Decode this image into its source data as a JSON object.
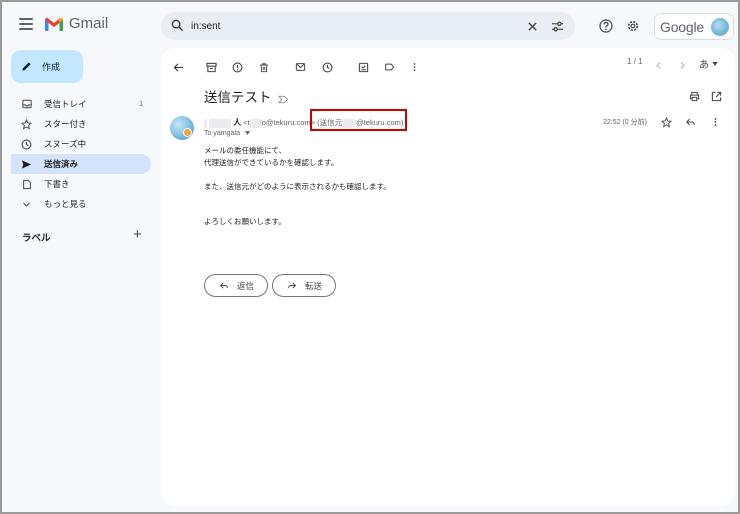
{
  "app": {
    "name": "Gmail"
  },
  "search": {
    "value": "in:sent"
  },
  "account": {
    "brand": "Google"
  },
  "sidebar": {
    "compose_label": "作成",
    "items": [
      {
        "label": "受信トレイ",
        "count": "1",
        "icon": "inbox-icon"
      },
      {
        "label": "スター付き",
        "count": "",
        "icon": "star-icon"
      },
      {
        "label": "スヌーズ中",
        "count": "",
        "icon": "clock-icon"
      },
      {
        "label": "送信済み",
        "count": "",
        "icon": "send-icon",
        "active": true
      },
      {
        "label": "下書き",
        "count": "",
        "icon": "draft-icon"
      },
      {
        "label": "もっと見る",
        "count": "",
        "icon": "chevron-down-icon"
      }
    ],
    "labels_heading": "ラベル"
  },
  "toolbar": {
    "pager": "1 / 1",
    "input_tool": "あ"
  },
  "email": {
    "subject": "送信テスト",
    "sender_name": "人",
    "sender_email_prefix": "<t",
    "sender_email_suffix": "o@tekuru.com>",
    "on_behalf_prefix": "(送信元",
    "on_behalf_suffix": "@tekuru.com)",
    "to": "To yamgata",
    "time": "22:52 (0 分前)",
    "body": [
      "メールの委任機能にて、",
      "代理送信ができているかを確認します。",
      "また、送信元がどのように表示されるかも確認します。",
      "よろしくお願いします。"
    ]
  },
  "actions": {
    "reply_label": "返信",
    "forward_label": "転送"
  },
  "colors": {
    "accent": "#c2e7ff",
    "active_nav": "#d3e3fd",
    "highlight": "#d00000",
    "search_bg": "#e9eef6"
  }
}
